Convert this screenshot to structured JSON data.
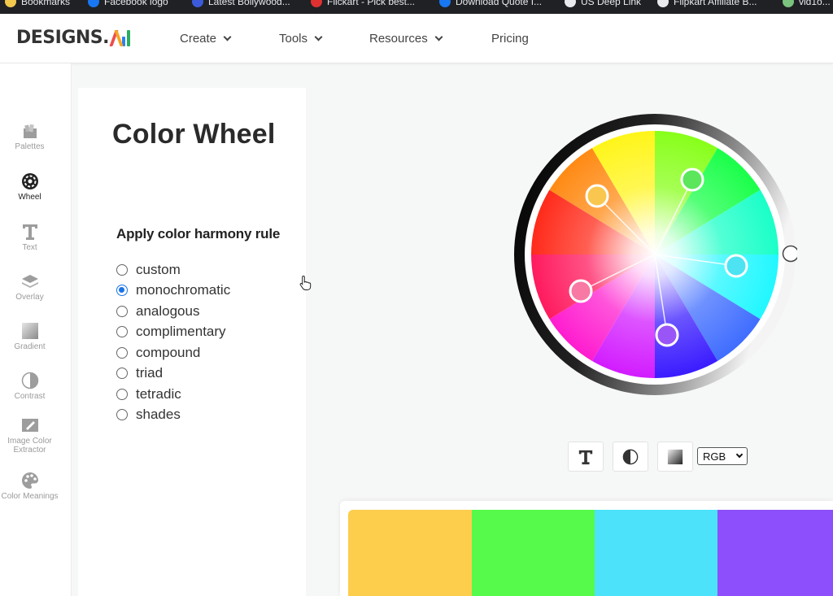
{
  "bookmarks": [
    {
      "label": "Bookmarks",
      "color": "#f2c94c"
    },
    {
      "label": "Facebook logo",
      "color": "#1877f2"
    },
    {
      "label": "Latest Bollywood...",
      "color": "#3b5bdb"
    },
    {
      "label": "Flickart - Pick best...",
      "color": "#e03131"
    },
    {
      "label": "Download Quote I...",
      "color": "#1877f2"
    },
    {
      "label": "US Deep Link",
      "color": "#e8eaed"
    },
    {
      "label": "Flipkart Affiliate B...",
      "color": "#e8eaed"
    },
    {
      "label": "vid1o...",
      "color": "#7bc47f"
    }
  ],
  "header": {
    "logo_text": "DESIGNS.",
    "nav": [
      {
        "label": "Create",
        "has_dropdown": true
      },
      {
        "label": "Tools",
        "has_dropdown": true
      },
      {
        "label": "Resources",
        "has_dropdown": true
      },
      {
        "label": "Pricing",
        "has_dropdown": false
      }
    ]
  },
  "sidebar": {
    "items": [
      {
        "label": "Palettes",
        "icon": "palettes-icon",
        "active": false
      },
      {
        "label": "Wheel",
        "icon": "wheel-icon",
        "active": true
      },
      {
        "label": "Text",
        "icon": "text-icon",
        "active": false
      },
      {
        "label": "Overlay",
        "icon": "overlay-icon",
        "active": false
      },
      {
        "label": "Gradient",
        "icon": "gradient-icon",
        "active": false
      },
      {
        "label": "Contrast",
        "icon": "contrast-icon",
        "active": false
      },
      {
        "label": "Image Color Extractor",
        "icon": "image-extractor-icon",
        "active": false
      },
      {
        "label": "Color Meanings",
        "icon": "color-meanings-icon",
        "active": false
      }
    ]
  },
  "main": {
    "title": "Color Wheel",
    "harmony_label": "Apply color harmony rule",
    "harmony_options": [
      "custom",
      "monochromatic",
      "analogous",
      "complimentary",
      "compound",
      "triad",
      "tetradic",
      "shades"
    ],
    "selected_harmony": "monochromatic"
  },
  "wheel": {
    "handles": [
      "#f9c74f",
      "#5be65b",
      "#4de3f2",
      "#9a55f7",
      "#f779a4"
    ],
    "brightness_handle_color": "#ffffff"
  },
  "tools": {
    "text_icon": "text-icon",
    "contrast_icon": "contrast-icon",
    "gradient_icon": "gradient-icon",
    "color_mode": "RGB"
  },
  "palette": {
    "swatches": [
      "#fdcd4c",
      "#55fa4a",
      "#4be2fa",
      "#8c4ffb"
    ]
  }
}
